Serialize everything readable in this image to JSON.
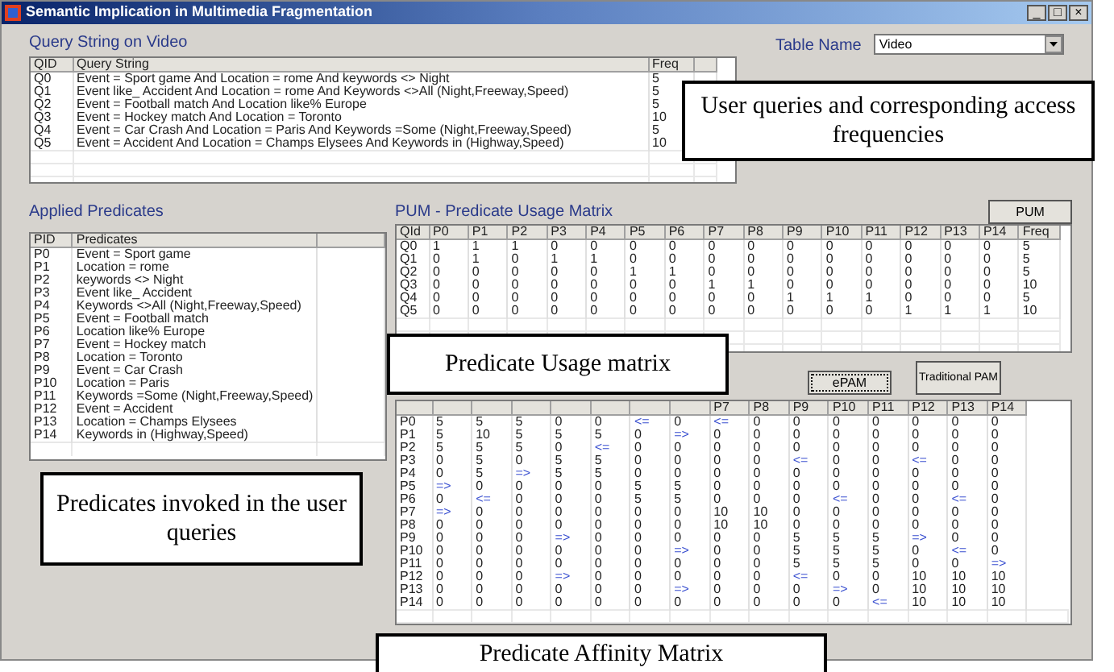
{
  "window": {
    "title": "Semantic Implication in Multimedia Fragmentation",
    "controls": [
      "_",
      "□",
      "×"
    ]
  },
  "query_section": {
    "title": "Query String on Video",
    "columns": [
      "QID",
      "Query String",
      "Freq"
    ],
    "rows": [
      [
        "Q0",
        "Event = Sport game And Location = rome And keywords <> Night",
        "5"
      ],
      [
        "Q1",
        "Event like_ Accident And Location = rome And  Keywords <>All (Night,Freeway,Speed)",
        "5"
      ],
      [
        "Q2",
        "Event = Football match And Location like% Europe",
        "5"
      ],
      [
        "Q3",
        "Event = Hockey match And Location = Toronto",
        "10"
      ],
      [
        "Q4",
        "Event = Car Crash And Location = Paris And  Keywords =Some (Night,Freeway,Speed)",
        "5"
      ],
      [
        "Q5",
        "Event = Accident And Location = Champs Elysees And Keywords in (Highway,Speed)",
        "10"
      ]
    ]
  },
  "table_name": {
    "label": "Table Name",
    "value": "Video"
  },
  "predicates_section": {
    "title": "Applied Predicates",
    "columns": [
      "PID",
      "Predicates"
    ],
    "rows": [
      [
        "P0",
        "Event = Sport game"
      ],
      [
        "P1",
        "Location = rome"
      ],
      [
        "P2",
        "keywords <> Night"
      ],
      [
        "P3",
        "Event like_ Accident"
      ],
      [
        "P4",
        "Keywords <>All (Night,Freeway,Speed)"
      ],
      [
        "P5",
        "Event = Football match"
      ],
      [
        "P6",
        "Location like% Europe"
      ],
      [
        "P7",
        "Event = Hockey match"
      ],
      [
        "P8",
        "Location = Toronto"
      ],
      [
        "P9",
        "Event = Car Crash"
      ],
      [
        "P10",
        "Location = Paris"
      ],
      [
        "P11",
        "Keywords =Some (Night,Freeway,Speed)"
      ],
      [
        "P12",
        "Event = Accident"
      ],
      [
        "P13",
        "Location = Champs Elysees"
      ],
      [
        "P14",
        "Keywords in (Highway,Speed)"
      ]
    ]
  },
  "pum_section": {
    "title": "PUM - Predicate Usage Matrix",
    "button": "PUM",
    "columns": [
      "QId",
      "P0",
      "P1",
      "P2",
      "P3",
      "P4",
      "P5",
      "P6",
      "P7",
      "P8",
      "P9",
      "P10",
      "P11",
      "P12",
      "P13",
      "P14",
      "Freq"
    ],
    "rows": [
      [
        "Q0",
        "1",
        "1",
        "1",
        "0",
        "0",
        "0",
        "0",
        "0",
        "0",
        "0",
        "0",
        "0",
        "0",
        "0",
        "0",
        "5"
      ],
      [
        "Q1",
        "0",
        "1",
        "0",
        "1",
        "1",
        "0",
        "0",
        "0",
        "0",
        "0",
        "0",
        "0",
        "0",
        "0",
        "0",
        "5"
      ],
      [
        "Q2",
        "0",
        "0",
        "0",
        "0",
        "0",
        "1",
        "1",
        "0",
        "0",
        "0",
        "0",
        "0",
        "0",
        "0",
        "0",
        "5"
      ],
      [
        "Q3",
        "0",
        "0",
        "0",
        "0",
        "0",
        "0",
        "0",
        "1",
        "1",
        "0",
        "0",
        "0",
        "0",
        "0",
        "0",
        "10"
      ],
      [
        "Q4",
        "0",
        "0",
        "0",
        "0",
        "0",
        "0",
        "0",
        "0",
        "0",
        "1",
        "1",
        "1",
        "0",
        "0",
        "0",
        "5"
      ],
      [
        "Q5",
        "0",
        "0",
        "0",
        "0",
        "0",
        "0",
        "0",
        "0",
        "0",
        "0",
        "0",
        "0",
        "1",
        "1",
        "1",
        "10"
      ]
    ]
  },
  "pam_section": {
    "buttons": [
      "ePAM",
      "Traditional PAM"
    ],
    "visible_columns": [
      "P7",
      "P8",
      "P9",
      "P10",
      "P11",
      "P12",
      "P13",
      "P14"
    ],
    "rows": [
      [
        "P0",
        "5",
        "5",
        "5",
        "0",
        "0",
        {
          "text": "<=",
          "kind": "arrow"
        },
        "0",
        {
          "text": "<=",
          "kind": "arrow"
        },
        "0",
        "0",
        "0",
        "0",
        "0",
        "0",
        "0"
      ],
      [
        "P1",
        "5",
        "10",
        "5",
        "5",
        "5",
        "0",
        {
          "text": "=>",
          "kind": "arrow"
        },
        "0",
        "0",
        "0",
        "0",
        "0",
        "0",
        "0",
        "0"
      ],
      [
        "P2",
        "5",
        "5",
        "5",
        "0",
        {
          "text": "<=",
          "kind": "arrow"
        },
        "0",
        "0",
        "0",
        "0",
        "0",
        "0",
        "0",
        "0",
        "0",
        "0"
      ],
      [
        "P3",
        "0",
        "5",
        "0",
        "5",
        "5",
        "0",
        "0",
        "0",
        "0",
        {
          "text": "<=",
          "kind": "arrow"
        },
        "0",
        "0",
        {
          "text": "<=",
          "kind": "arrow"
        },
        "0",
        "0"
      ],
      [
        "P4",
        "0",
        "5",
        {
          "text": "=>",
          "kind": "arrow"
        },
        "5",
        "5",
        "0",
        "0",
        "0",
        "0",
        "0",
        "0",
        "0",
        "0",
        "0",
        "0"
      ],
      [
        "P5",
        {
          "text": "=>",
          "kind": "arrow"
        },
        "0",
        "0",
        "0",
        "0",
        "5",
        "5",
        "0",
        "0",
        "0",
        "0",
        "0",
        "0",
        "0",
        "0"
      ],
      [
        "P6",
        "0",
        {
          "text": "<=",
          "kind": "arrow"
        },
        "0",
        "0",
        "0",
        "5",
        "5",
        "0",
        "0",
        "0",
        {
          "text": "<=",
          "kind": "arrow"
        },
        "0",
        "0",
        {
          "text": "<=",
          "kind": "arrow"
        },
        "0"
      ],
      [
        "P7",
        {
          "text": "=>",
          "kind": "arrow"
        },
        "0",
        "0",
        "0",
        "0",
        "0",
        "0",
        "10",
        "10",
        "0",
        "0",
        "0",
        "0",
        "0",
        "0"
      ],
      [
        "P8",
        "0",
        "0",
        "0",
        "0",
        "0",
        "0",
        "0",
        "10",
        "10",
        "0",
        "0",
        "0",
        "0",
        "0",
        "0"
      ],
      [
        "P9",
        "0",
        "0",
        "0",
        {
          "text": "=>",
          "kind": "arrow"
        },
        "0",
        "0",
        "0",
        "0",
        "0",
        "5",
        "5",
        "5",
        {
          "text": "=>",
          "kind": "arrow"
        },
        "0",
        "0"
      ],
      [
        "P10",
        "0",
        "0",
        "0",
        "0",
        "0",
        "0",
        {
          "text": "=>",
          "kind": "arrow"
        },
        "0",
        "0",
        "5",
        "5",
        "5",
        "0",
        {
          "text": "<=",
          "kind": "arrow"
        },
        "0"
      ],
      [
        "P11",
        "0",
        "0",
        "0",
        "0",
        "0",
        "0",
        "0",
        "0",
        "0",
        "5",
        "5",
        "5",
        "0",
        "0",
        {
          "text": "=>",
          "kind": "arrow"
        }
      ],
      [
        "P12",
        "0",
        "0",
        "0",
        {
          "text": "=>",
          "kind": "arrow"
        },
        "0",
        "0",
        "0",
        "0",
        "0",
        {
          "text": "<=",
          "kind": "arrow"
        },
        "0",
        "0",
        "10",
        "10",
        "10"
      ],
      [
        "P13",
        "0",
        "0",
        "0",
        "0",
        "0",
        "0",
        {
          "text": "=>",
          "kind": "arrow"
        },
        "0",
        "0",
        "0",
        {
          "text": "=>",
          "kind": "arrow"
        },
        "0",
        "10",
        "10",
        "10"
      ],
      [
        "P14",
        "0",
        "0",
        "0",
        "0",
        "0",
        "0",
        "0",
        "0",
        "0",
        "0",
        "0",
        {
          "text": "<=",
          "kind": "arrow"
        },
        "10",
        "10",
        "10"
      ]
    ]
  },
  "callouts": [
    "User queries and corresponding access frequencies",
    "Predicate Usage matrix",
    "Predicates invoked in the user queries",
    "Predicate Affinity Matrix"
  ]
}
